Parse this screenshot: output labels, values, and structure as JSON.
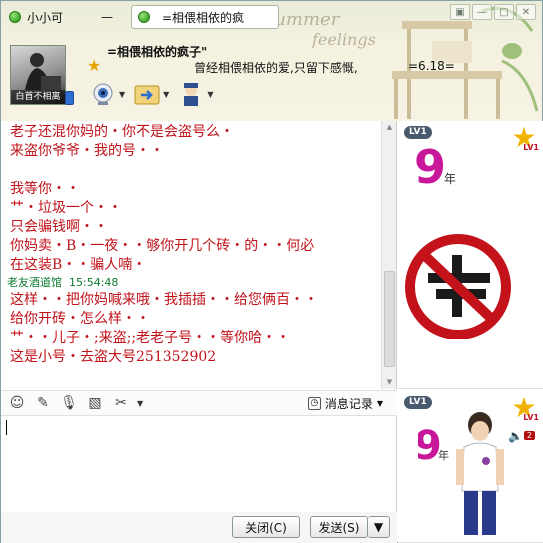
{
  "title_bar": {
    "contact_tab": "小小可",
    "minimize_tab": "—",
    "active_tab": "=相偎相依的疯"
  },
  "header": {
    "contact_name": "=相偎相依的疯子\"",
    "signature": "曾经相偎相依的爱,只留下感慨,",
    "signature_extra": "=6.18=",
    "avatar_caption": "白首不相离"
  },
  "chat": {
    "lines_a": [
      "老子还混你妈的・你不是会盗号么・",
      "来盗你爷爷・我的号・・",
      "",
      "我等你・・",
      "艹・垃圾一个・・",
      "只会骗钱啊・・",
      "你妈卖・B・一夜・・够你开几个砖・的・・何必",
      "在这装B・・骗人喃・"
    ],
    "sender": "老友酒道馆",
    "sender_time": "15:54:48",
    "lines_b": [
      "这样・・把你妈喊来哦・我插插・・给您俩百・・",
      "给你开砖・怎么样・・",
      "艹・・儿子・;来盗;;老老子号・・等你哈・・",
      "这是小号・去盗大号251352902"
    ]
  },
  "input_toolbar": {
    "history_label": "消息记录"
  },
  "buttons": {
    "close": "关闭(C)",
    "send": "发送(S)",
    "send_more": "▼"
  },
  "right_panel": {
    "level_top": "LV1",
    "rank_top": "LV1",
    "level_bottom": "LV1",
    "rank_bottom": "LV1",
    "nine_text": "9",
    "nine_suffix": "年",
    "speaker_count": "2"
  },
  "colors": {
    "message_red": "#c0121a",
    "sender_green": "#0d7b2f"
  }
}
